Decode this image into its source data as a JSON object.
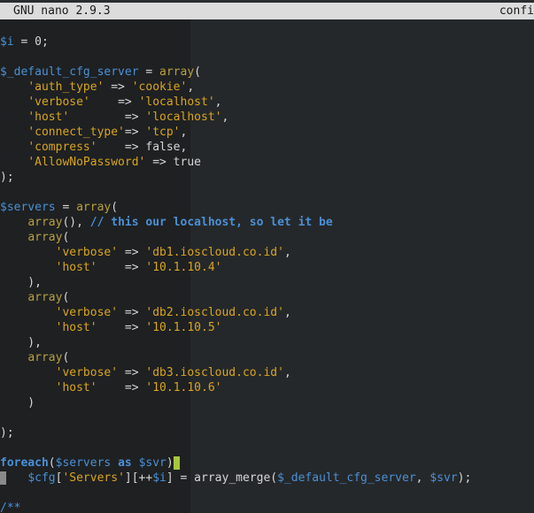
{
  "titlebar": {
    "app": "GNU nano 2.9.3",
    "file": "confi"
  },
  "code": {
    "l1": {
      "a": "$i",
      "b": " = 0;"
    },
    "l3": {
      "a": "$_default_cfg_server",
      "b": " = ",
      "c": "array",
      "d": "("
    },
    "l4": {
      "a": "    ",
      "b": "'auth_type'",
      "c": " => ",
      "d": "'cookie'",
      "e": ","
    },
    "l5": {
      "a": "    ",
      "b": "'verbose'",
      "c": "    => ",
      "d": "'localhost'",
      "e": ","
    },
    "l6": {
      "a": "    ",
      "b": "'host'",
      "c": "        => ",
      "d": "'localhost'",
      "e": ","
    },
    "l7": {
      "a": "    ",
      "b": "'connect_type'",
      "c": "=> ",
      "d": "'tcp'",
      "e": ","
    },
    "l8": {
      "a": "    ",
      "b": "'compress'",
      "c": "    => false,"
    },
    "l9": {
      "a": "    ",
      "b": "'AllowNoPassword'",
      "c": " => true"
    },
    "l10": {
      "a": ");"
    },
    "l12": {
      "a": "$servers",
      "b": " = ",
      "c": "array",
      "d": "("
    },
    "l13": {
      "a": "    ",
      "b": "array",
      "c": "(), ",
      "d": "// this our localhost, so let it be"
    },
    "l14": {
      "a": "    ",
      "b": "array",
      "c": "("
    },
    "l15": {
      "a": "        ",
      "b": "'verbose'",
      "c": " => ",
      "d": "'db1.ioscloud.co.id'",
      "e": ","
    },
    "l16": {
      "a": "        ",
      "b": "'host'",
      "c": "    => ",
      "d": "'10.1.10.4'"
    },
    "l17": {
      "a": "    ),"
    },
    "l18": {
      "a": "    ",
      "b": "array",
      "c": "("
    },
    "l19": {
      "a": "        ",
      "b": "'verbose'",
      "c": " => ",
      "d": "'db2.ioscloud.co.id'",
      "e": ","
    },
    "l20": {
      "a": "        ",
      "b": "'host'",
      "c": "    => ",
      "d": "'10.1.10.5'"
    },
    "l21": {
      "a": "    ),"
    },
    "l22": {
      "a": "    ",
      "b": "array",
      "c": "("
    },
    "l23": {
      "a": "        ",
      "b": "'verbose'",
      "c": " => ",
      "d": "'db3.ioscloud.co.id'",
      "e": ","
    },
    "l24": {
      "a": "        ",
      "b": "'host'",
      "c": "    => ",
      "d": "'10.1.10.6'"
    },
    "l25": {
      "a": "    )"
    },
    "l27": {
      "a": ");"
    },
    "l29": {
      "a": "foreach",
      "b": "(",
      "c": "$servers",
      "d": " ",
      "e": "as",
      "f": " ",
      "g": "$svr",
      "h": ")"
    },
    "l30": {
      "a": "    ",
      "b": "$cfg",
      "c": "[",
      "d": "'Servers'",
      "e": "][++",
      "f": "$i",
      "g": "] = array_merge(",
      "h": "$_default_cfg_server",
      "i": ", ",
      "j": "$svr",
      "k": ");"
    },
    "l32": {
      "a": "/**"
    }
  }
}
